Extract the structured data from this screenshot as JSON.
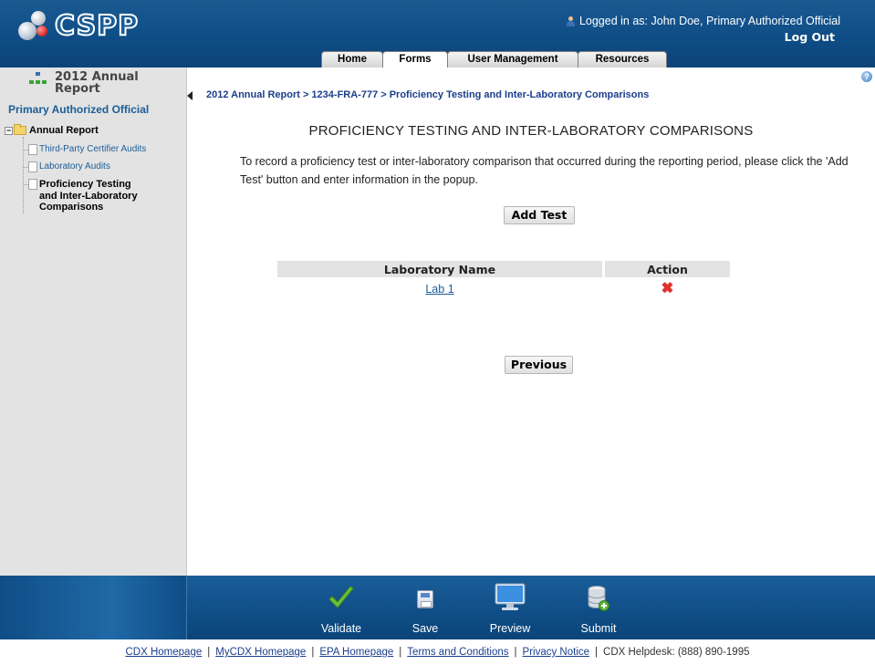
{
  "header": {
    "logo_text": "CSPP",
    "login_text": "Logged in as: John Doe, Primary Authorized Official",
    "logout_label": "Log Out",
    "tabs": [
      {
        "label": "Home"
      },
      {
        "label": "Forms",
        "active": true
      },
      {
        "label": "User Management"
      },
      {
        "label": "Resources"
      }
    ]
  },
  "sidebar": {
    "title_line1": "2012 Annual",
    "title_line2": "Report",
    "role": "Primary Authorized Official",
    "tree": {
      "root_label": "Annual Report",
      "expander": "−",
      "items": [
        {
          "label": "Third-Party Certifier Audits"
        },
        {
          "label": "Laboratory Audits"
        },
        {
          "label": "Proficiency Testing and Inter-Laboratory Comparisons",
          "current": true
        }
      ]
    }
  },
  "main": {
    "help": "?",
    "breadcrumb": "2012 Annual Report > 1234-FRA-777 > Proficiency Testing and Inter-Laboratory Comparisons",
    "title": "PROFICIENCY TESTING AND INTER-LABORATORY COMPARISONS",
    "instructions": "To record a proficiency test or inter-laboratory comparison that occurred during the reporting period, please click the 'Add Test' button and enter information in the popup.",
    "add_button": "Add Test",
    "table": {
      "headers": [
        "Laboratory Name",
        "Action"
      ],
      "rows": [
        {
          "name": "Lab 1",
          "action_icon": "delete-icon",
          "action_glyph": "✖"
        }
      ]
    },
    "previous_button": "Previous"
  },
  "actions": [
    {
      "label": "Validate",
      "icon": "check-icon"
    },
    {
      "label": "Save",
      "icon": "save-icon"
    },
    {
      "label": "Preview",
      "icon": "monitor-icon"
    },
    {
      "label": "Submit",
      "icon": "database-icon"
    }
  ],
  "footer": {
    "links": [
      "CDX Homepage",
      "MyCDX Homepage",
      "EPA Homepage",
      "Terms and Conditions",
      "Privacy Notice"
    ],
    "helpdesk": "CDX Helpdesk: (888) 890-1995"
  },
  "colors": {
    "header_blue": "#0f4d86",
    "link_blue": "#1b5d97",
    "sidebar_bg": "#e3e3e3",
    "delete_red": "#e0312a",
    "check_green": "#5aa82a"
  }
}
